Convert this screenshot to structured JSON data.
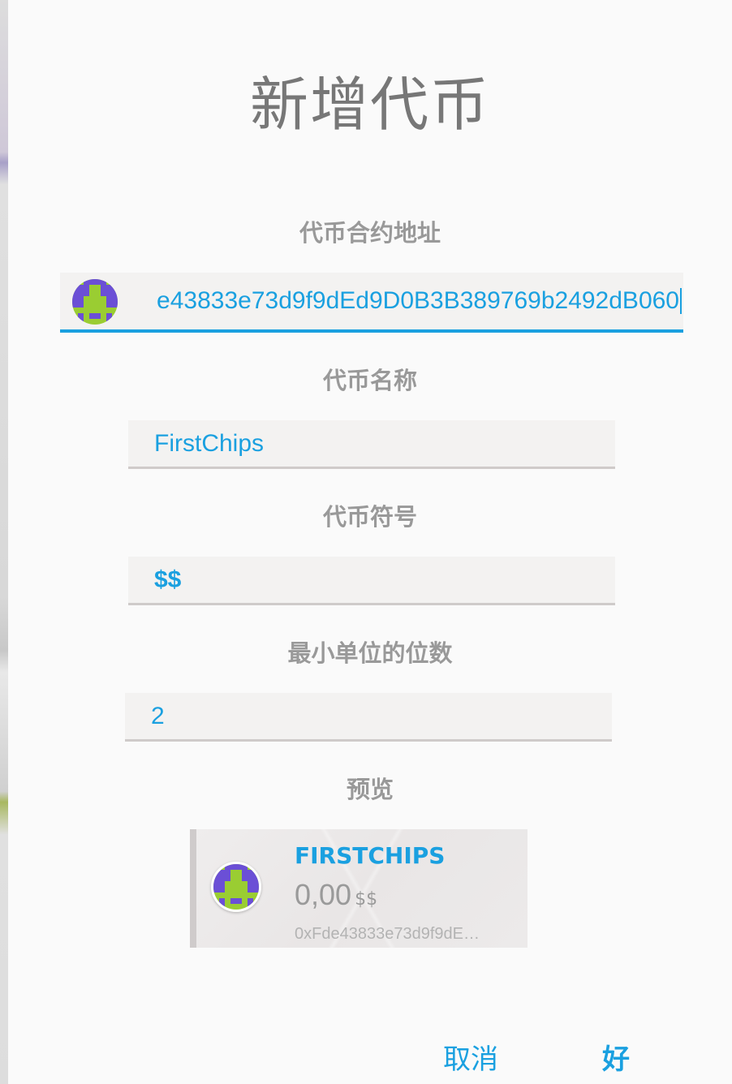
{
  "dialog": {
    "title": "新增代币",
    "labels": {
      "address": "代币合约地址",
      "name": "代币名称",
      "symbol": "代币符号",
      "decimals": "最小单位的位数",
      "preview": "预览"
    },
    "fields": {
      "address_value": "e43833e73d9f9dEd9D0B3B389769b2492dB060",
      "name_value": "FirstChips",
      "symbol_value": "$$",
      "decimals_value": "2"
    },
    "preview": {
      "token_name": "FIRSTCHIPS",
      "balance": "0,00",
      "symbol": "$$",
      "address": "0xFde43833e73d9f9dE…"
    },
    "buttons": {
      "cancel": "取消",
      "ok": "好"
    },
    "colors": {
      "accent": "#1aa0e0",
      "identicon_purple": "#6b4fd6",
      "identicon_green": "#9acd32"
    },
    "icons": {
      "address_identicon": "token-identicon",
      "preview_identicon": "token-identicon"
    }
  }
}
